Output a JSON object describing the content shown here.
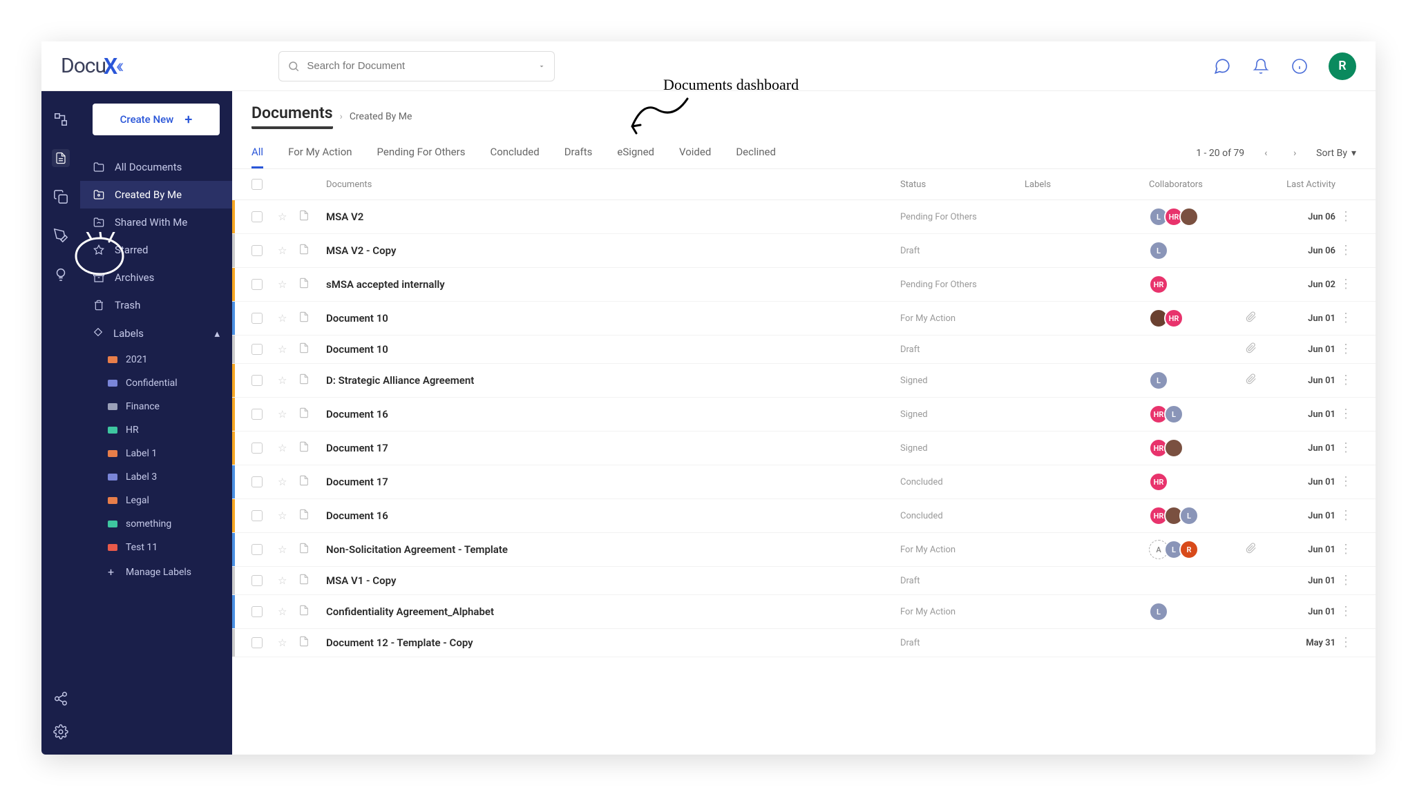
{
  "brand": {
    "name": "Docu",
    "accent": "X"
  },
  "search": {
    "placeholder": "Search for Document"
  },
  "user": {
    "initial": "R",
    "color": "#0a8a5e"
  },
  "annotation": "Documents dashboard",
  "sidebar": {
    "create_label": "Create New",
    "items": [
      {
        "label": "All Documents",
        "icon": "folder"
      },
      {
        "label": "Created By Me",
        "icon": "folder-user",
        "active": true
      },
      {
        "label": "Shared With Me",
        "icon": "folder-share"
      },
      {
        "label": "Starred",
        "icon": "star"
      },
      {
        "label": "Archives",
        "icon": "archive"
      },
      {
        "label": "Trash",
        "icon": "trash"
      }
    ],
    "labels_header": "Labels",
    "labels": [
      {
        "name": "2021",
        "color": "#e87e4a"
      },
      {
        "name": "Confidential",
        "color": "#7a85d8"
      },
      {
        "name": "Finance",
        "color": "#9aa0b8"
      },
      {
        "name": "HR",
        "color": "#3ec6a0"
      },
      {
        "name": "Label 1",
        "color": "#e87e4a"
      },
      {
        "name": "Label 3",
        "color": "#7a85d8"
      },
      {
        "name": "Legal",
        "color": "#e87e4a"
      },
      {
        "name": "something",
        "color": "#3ec6a0"
      },
      {
        "name": "Test 11",
        "color": "#e85a4a"
      }
    ],
    "manage_labels": "Manage Labels"
  },
  "page": {
    "title": "Documents",
    "breadcrumb": "Created By Me"
  },
  "tabs": [
    "All",
    "For My Action",
    "Pending For Others",
    "Concluded",
    "Drafts",
    "eSigned",
    "Voided",
    "Declined"
  ],
  "active_tab_index": 0,
  "pager": {
    "range": "1 - 20 of 79",
    "sort_label": "Sort By"
  },
  "columns": {
    "documents": "Documents",
    "status": "Status",
    "labels": "Labels",
    "collaborators": "Collaborators",
    "last_activity": "Last Activity"
  },
  "collab_palette": {
    "L": "#8a95b8",
    "HR": "#e8336c",
    "R": "#d84a1a",
    "A": "#ffffff",
    "photo1": "#7a5040",
    "photo2": "#6a4030"
  },
  "rows": [
    {
      "bar": "yellow",
      "name": "MSA V2",
      "status": "Pending For Others",
      "collab": [
        "L",
        "HR",
        "photo1"
      ],
      "attach": false,
      "date": "Jun 06"
    },
    {
      "bar": "grey",
      "name": "MSA V2 - Copy",
      "status": "Draft",
      "collab": [
        "L"
      ],
      "attach": false,
      "date": "Jun 06"
    },
    {
      "bar": "yellow",
      "name": "sMSA accepted internally",
      "status": "Pending For Others",
      "collab": [
        "HR"
      ],
      "attach": false,
      "date": "Jun 02"
    },
    {
      "bar": "blue",
      "name": "Document 10",
      "status": "For My Action",
      "collab": [
        "photo2",
        "HR"
      ],
      "attach": true,
      "date": "Jun 01"
    },
    {
      "bar": "grey",
      "name": "Document 10",
      "status": "Draft",
      "collab": [],
      "attach": true,
      "date": "Jun 01"
    },
    {
      "bar": "yellow",
      "name": "D: Strategic Alliance Agreement",
      "status": "Signed",
      "collab": [
        "L"
      ],
      "attach": true,
      "date": "Jun 01"
    },
    {
      "bar": "yellow",
      "name": "Document 16",
      "status": "Signed",
      "collab": [
        "HR",
        "L"
      ],
      "attach": false,
      "date": "Jun 01"
    },
    {
      "bar": "yellow",
      "name": "Document 17",
      "status": "Signed",
      "collab": [
        "HR",
        "photo1"
      ],
      "attach": false,
      "date": "Jun 01"
    },
    {
      "bar": "blue",
      "name": "Document 17",
      "status": "Concluded",
      "collab": [
        "HR"
      ],
      "attach": false,
      "date": "Jun 01"
    },
    {
      "bar": "yellow",
      "name": "Document 16",
      "status": "Concluded",
      "collab": [
        "HR",
        "photo1",
        "L"
      ],
      "attach": false,
      "date": "Jun 01"
    },
    {
      "bar": "blue",
      "name": "Non-Solicitation Agreement - Template",
      "status": "For My Action",
      "collab": [
        "A",
        "L",
        "R"
      ],
      "attach": true,
      "date": "Jun 01"
    },
    {
      "bar": "grey",
      "name": "MSA V1 - Copy",
      "status": "Draft",
      "collab": [],
      "attach": false,
      "date": "Jun 01"
    },
    {
      "bar": "blue",
      "name": "Confidentiality Agreement_Alphabet",
      "status": "For My Action",
      "collab": [
        "L"
      ],
      "attach": false,
      "date": "Jun 01"
    },
    {
      "bar": "grey",
      "name": "Document 12 - Template - Copy",
      "status": "Draft",
      "collab": [],
      "attach": false,
      "date": "May 31"
    }
  ]
}
